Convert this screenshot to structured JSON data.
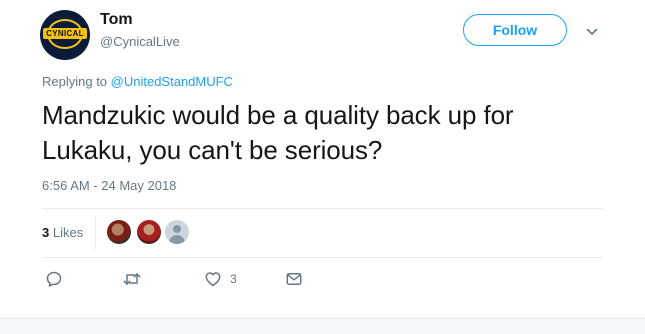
{
  "author": {
    "name": "Tom",
    "handle": "@CynicalLive",
    "avatar_text": "CYNICAL"
  },
  "follow_label": "Follow",
  "reply": {
    "prefix": "Replying to ",
    "mention": "@UnitedStandMUFC"
  },
  "tweet": {
    "text": "Mandzukic would be a quality back up for Lukaku, you can't be serious?",
    "timestamp": "6:56 AM - 24 May 2018"
  },
  "likes": {
    "count": "3",
    "label": "Likes"
  },
  "actions": {
    "reply_icon": "reply-icon",
    "retweet_icon": "retweet-icon",
    "like_icon": "heart-icon",
    "like_count": "3",
    "dm_icon": "envelope-icon"
  },
  "colors": {
    "accent": "#1da1f2",
    "secondary_text": "#657786",
    "primary_text": "#14171a"
  }
}
